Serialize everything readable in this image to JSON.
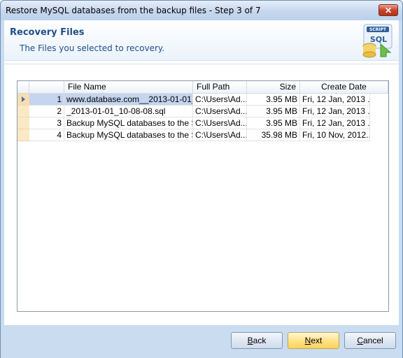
{
  "window": {
    "title": "Restore MySQL databases from the backup files - Step 3 of 7",
    "close_label": "✕"
  },
  "header": {
    "title": "Recovery Files",
    "subtitle": "The Files you selected to recovery.",
    "logo_text_top": "SCRIPT",
    "logo_text_main": "SQL"
  },
  "grid": {
    "columns": [
      "",
      "File Name",
      "Full Path",
      "Size",
      "Create Date"
    ],
    "rows": [
      {
        "num": "1",
        "file_name": "www.database.com__2013-01-01_...",
        "full_path": "C:\\Users\\Ad...",
        "size": "3.95 MB",
        "create_date": "Fri, 12 Jan, 2013 ...",
        "selected": true
      },
      {
        "num": "2",
        "file_name": "_2013-01-01_10-08-08.sql",
        "full_path": "C:\\Users\\Ad...",
        "size": "3.95 MB",
        "create_date": "Fri, 12 Jan, 2013 ...",
        "selected": false
      },
      {
        "num": "3",
        "file_name": "Backup MySQL databases to the S...",
        "full_path": "C:\\Users\\Ad...",
        "size": "3.95 MB",
        "create_date": "Fri, 12 Jan, 2013 ...",
        "selected": false
      },
      {
        "num": "4",
        "file_name": "Backup MySQL databases to the S...",
        "full_path": "C:\\Users\\Ad...",
        "size": "35.98 MB",
        "create_date": "Fri, 10 Nov, 2012...",
        "selected": false
      }
    ]
  },
  "buttons": {
    "back": {
      "mnemonic": "B",
      "rest": "ack"
    },
    "next": {
      "mnemonic": "N",
      "rest": "ext"
    },
    "cancel": {
      "mnemonic": "C",
      "rest": "ancel"
    }
  },
  "colors": {
    "accent": "#1f4f8c",
    "selection": "#c5d4ef",
    "primary_button": "#ffe28a"
  }
}
